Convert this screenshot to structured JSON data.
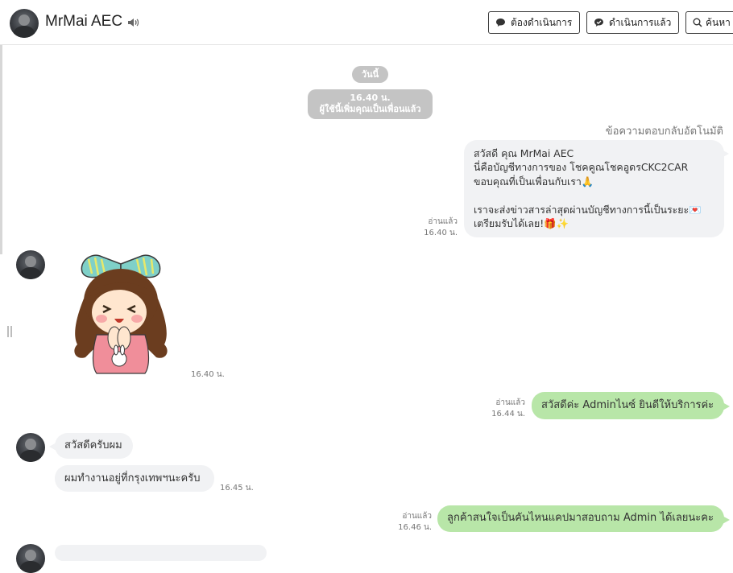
{
  "header": {
    "contact_name": "MrMai AEC",
    "buttons": [
      {
        "label": "ต้องดำเนินการ"
      },
      {
        "label": "ดำเนินการแล้ว"
      },
      {
        "label": "ค้นหา"
      }
    ]
  },
  "date_separator": "วันนี้",
  "system_notice": {
    "time": "16.40 น.",
    "text": "ผู้ใช้นี้เพิ่มคุณเป็นเพื่อนแล้ว"
  },
  "auto_reply_label": "ข้อความตอบกลับอัตโนมัติ",
  "messages": [
    {
      "from": "me",
      "text": "สวัสดี คุณ MrMai AEC\nนี่คือบัญชีทางการของ โชคคูณโชคอูดรCKC2CAR\nขอบคุณที่เป็นเพื่อนกับเรา🙏\n\nเราจะส่งข่าวสารล่าสุดผ่านบัญชีทางการนี้เป็นระยะ💌\nเตรียมรับได้เลย!🎁✨",
      "status": "อ่านแล้ว",
      "time": "16.40 น."
    },
    {
      "from": "user",
      "type": "sticker",
      "time": "16.40 น."
    },
    {
      "from": "me",
      "text": "สวัสดีค่ะ Adminไนซ์ ยินดีให้บริการค่ะ",
      "status": "อ่านแล้ว",
      "time": "16.44 น."
    },
    {
      "from": "user",
      "text": "สวัสดีครับผม"
    },
    {
      "from": "user",
      "text": "ผมทำงานอยู่ที่กรุงเทพฯนะครับ",
      "time": "16.45 น."
    },
    {
      "from": "me",
      "text": "ลูกค้าสนใจเป็นคันไหนแคปมาสอบถาม Admin ได้เลยนะคะ",
      "status": "อ่านแล้ว",
      "time": "16.46 น."
    }
  ]
}
